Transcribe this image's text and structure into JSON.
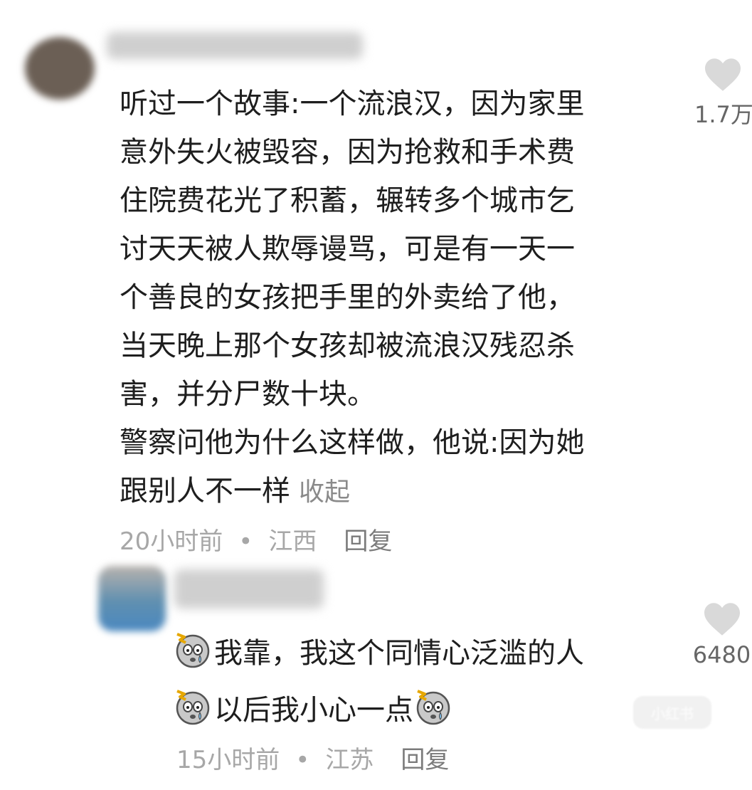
{
  "comments": [
    {
      "text_lines": [
        "听过一个故事:一个流浪汉，因为家里",
        "意外失火被毁容，因为抢救和手术费",
        "住院费花光了积蓄，辗转多个城市乞",
        "讨天天被人欺辱谩骂，可是有一天一",
        "个善良的女孩把手里的外卖给了他，",
        "当天晚上那个女孩却被流浪汉残忍杀",
        "害，并分尸数十块。",
        "警察问他为什么这样做，他说:因为她",
        "跟别人不一样"
      ],
      "collapse_label": "收起",
      "time": "20小时前",
      "location": "江西",
      "reply_label": "回复",
      "like_count": "1.7万",
      "like_icon": "heart-icon"
    },
    {
      "line1": "我靠，我这个同情心泛滥的人",
      "line2": "以后我小心一点",
      "emoji_icon": "scared-sweat-emoji-icon",
      "time": "15小时前",
      "location": "江苏",
      "reply_label": "回复",
      "like_count": "6480",
      "like_icon": "heart-icon"
    }
  ],
  "watermark": "小红书",
  "colors": {
    "text": "#1e1e1e",
    "meta": "#a7a7a7",
    "reply": "#7b7b7b",
    "heart": "#d9d9d9"
  }
}
